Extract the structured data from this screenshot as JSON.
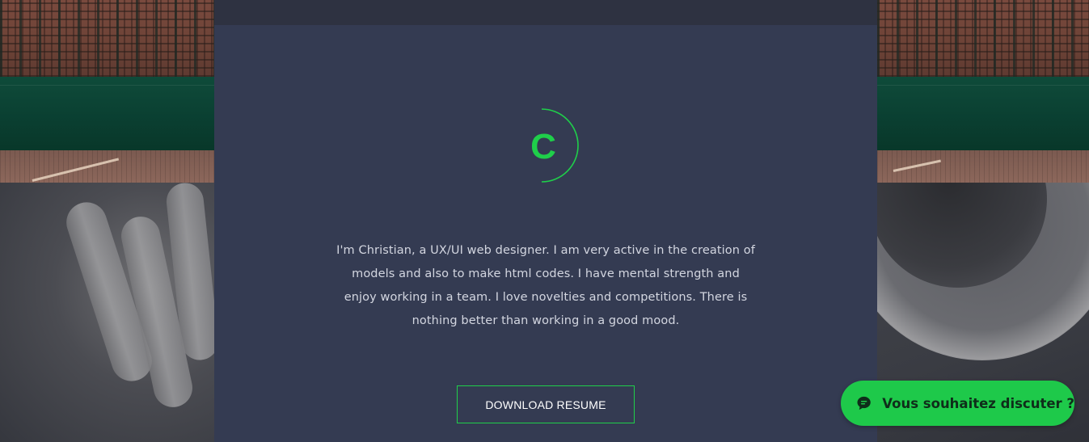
{
  "logo": {
    "letter": "C",
    "accent_color": "#1fcf4a"
  },
  "bio": {
    "text": "I'm Christian, a UX/UI web designer. I am very active in the creation of models and also to make html codes. I have mental strength and enjoy working in a team. I love novelties and competitions. There is nothing better than working in a good mood."
  },
  "resume_button": {
    "label": "DOWNLOAD RESUME"
  },
  "chat_widget": {
    "label": "Vous souhaitez discuter ?",
    "icon": "chat-bubble-icon",
    "color": "#1ec94a"
  },
  "colors": {
    "card": "#343b52",
    "text": "#d3d6e0",
    "accent": "#1fcf4a"
  }
}
